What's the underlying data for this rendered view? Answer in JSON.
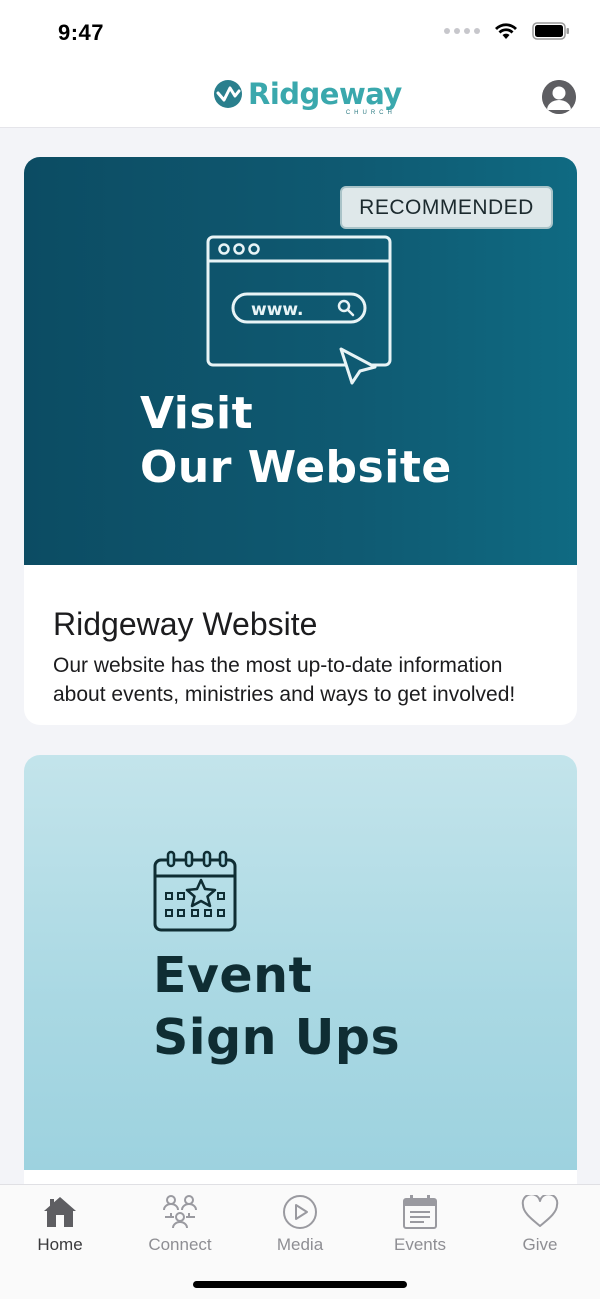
{
  "status_bar": {
    "time": "9:47",
    "icons": [
      "cellular-dots-icon",
      "wifi-icon",
      "battery-icon"
    ]
  },
  "header": {
    "logo_text": "Ridgeway",
    "logo_subtext": "CHURCH",
    "profile_icon": "person-circle-icon"
  },
  "cards": [
    {
      "badge": "RECOMMENDED",
      "banner_line_1": "Visit",
      "banner_line_2": "Our Website",
      "banner_icon": "browser-window-icon",
      "browser_url_text": "www.",
      "title": "Ridgeway Website",
      "description": "Our website has the most up-to-date information about events, ministries and ways to get involved!"
    },
    {
      "banner_line_1": "Event",
      "banner_line_2": "Sign Ups",
      "banner_icon": "calendar-star-icon"
    }
  ],
  "tab_bar": {
    "tabs": [
      {
        "label": "Home",
        "icon": "home-icon",
        "active": true
      },
      {
        "label": "Connect",
        "icon": "people-icon",
        "active": false
      },
      {
        "label": "Media",
        "icon": "play-circle-icon",
        "active": false
      },
      {
        "label": "Events",
        "icon": "calendar-icon",
        "active": false
      },
      {
        "label": "Give",
        "icon": "heart-icon",
        "active": false
      }
    ]
  },
  "colors": {
    "brand_teal": "#3aa8ad",
    "banner_dark": "#0f5a72",
    "banner_light": "#a9d8e3",
    "tab_inactive": "#8e8e93",
    "tab_active": "#3a3a3c"
  }
}
